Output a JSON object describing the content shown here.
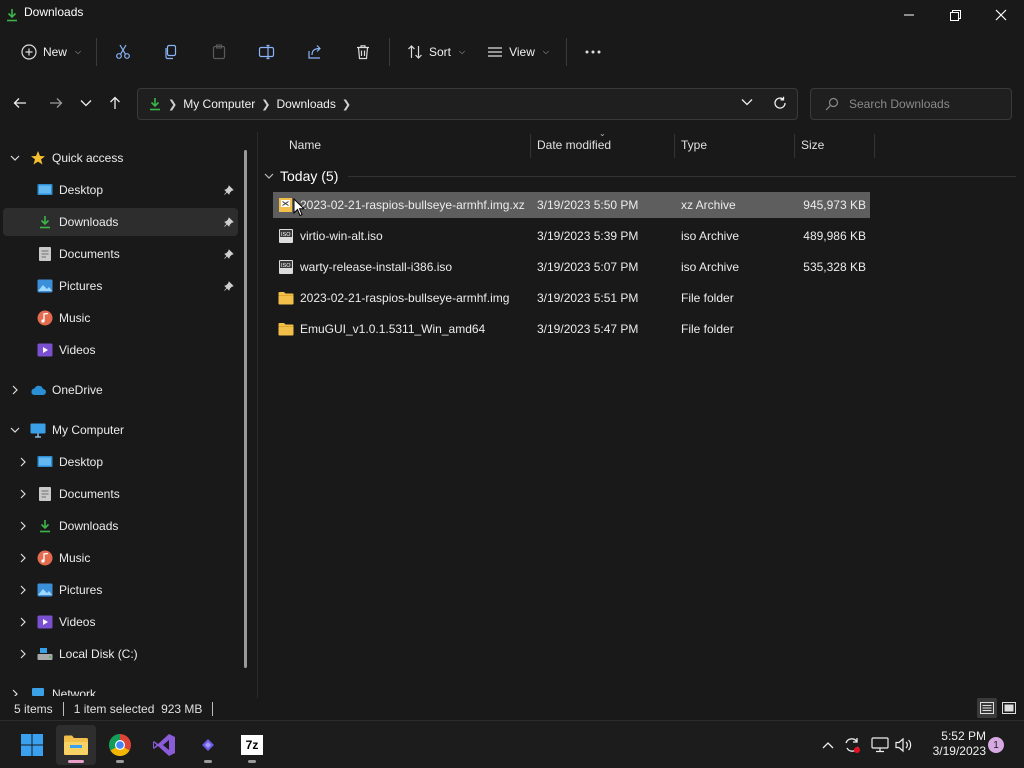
{
  "window": {
    "title": "Downloads"
  },
  "command_bar": {
    "new_label": "New",
    "sort_label": "Sort",
    "view_label": "View"
  },
  "address": {
    "crumbs": [
      "My Computer",
      "Downloads"
    ],
    "search_placeholder": "Search Downloads"
  },
  "nav_pane": {
    "quick_access": "Quick access",
    "quick_items": [
      "Desktop",
      "Downloads",
      "Documents",
      "Pictures",
      "Music",
      "Videos"
    ],
    "onedrive": "OneDrive",
    "my_computer": "My Computer",
    "computer_items": [
      "Desktop",
      "Documents",
      "Downloads",
      "Music",
      "Pictures",
      "Videos",
      "Local Disk (C:)"
    ],
    "network": "Network"
  },
  "columns": {
    "name": "Name",
    "date": "Date modified",
    "type": "Type",
    "size": "Size"
  },
  "group": {
    "label": "Today (5)"
  },
  "files": [
    {
      "name": "2023-02-21-raspios-bullseye-armhf.img.xz",
      "date": "3/19/2023 5:50 PM",
      "type": "xz Archive",
      "size": "945,973 KB"
    },
    {
      "name": "virtio-win-alt.iso",
      "date": "3/19/2023 5:39 PM",
      "type": "iso Archive",
      "size": "489,986 KB"
    },
    {
      "name": "warty-release-install-i386.iso",
      "date": "3/19/2023 5:07 PM",
      "type": "iso Archive",
      "size": "535,328 KB"
    },
    {
      "name": "2023-02-21-raspios-bullseye-armhf.img",
      "date": "3/19/2023 5:51 PM",
      "type": "File folder",
      "size": ""
    },
    {
      "name": "EmuGUI_v1.0.1.5311_Win_amd64",
      "date": "3/19/2023 5:47 PM",
      "type": "File folder",
      "size": ""
    }
  ],
  "status": {
    "item_count": "5 items",
    "selection": "1 item selected  923 MB"
  },
  "taskbar": {
    "time": "5:52 PM",
    "date": "3/19/2023",
    "notification_count": "1",
    "sevenzip_label": "7z"
  },
  "colors": {
    "accent_green": "#3bb54a",
    "folder_yellow": "#f2c04a",
    "selection_bg": "#5e5e5e"
  }
}
